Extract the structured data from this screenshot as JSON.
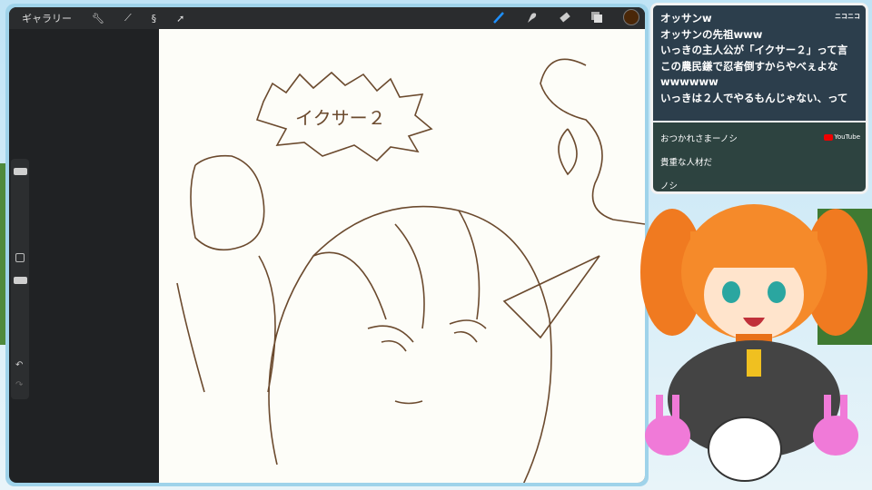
{
  "toolbar": {
    "gallery": "ギャラリー",
    "icons": [
      "wrench-icon",
      "adjust-icon",
      "selection-icon",
      "transform-icon"
    ],
    "right_icons": [
      "brush-icon",
      "smudge-icon",
      "eraser-icon",
      "layers-icon"
    ],
    "color": "#4a2708"
  },
  "canvas": {
    "speech_bubble": "イクサー２"
  },
  "chat": {
    "niconico_label": "ニコニコ",
    "niconico": [
      "オッサンw",
      "オッサンの先祖www",
      "いっきの主人公が「イクサー２」って言",
      "この農民鎌で忍者倒すからやべぇよな",
      "wwwwww",
      "いっきは２人でやるもんじゃない、って"
    ],
    "youtube_label": "YouTube",
    "youtube": [
      "おつかれさまーノシ",
      "貴重な人材だ",
      "ノシ"
    ]
  },
  "colors": {
    "ink": "#6b4a2e",
    "accent": "#1e90ff"
  }
}
